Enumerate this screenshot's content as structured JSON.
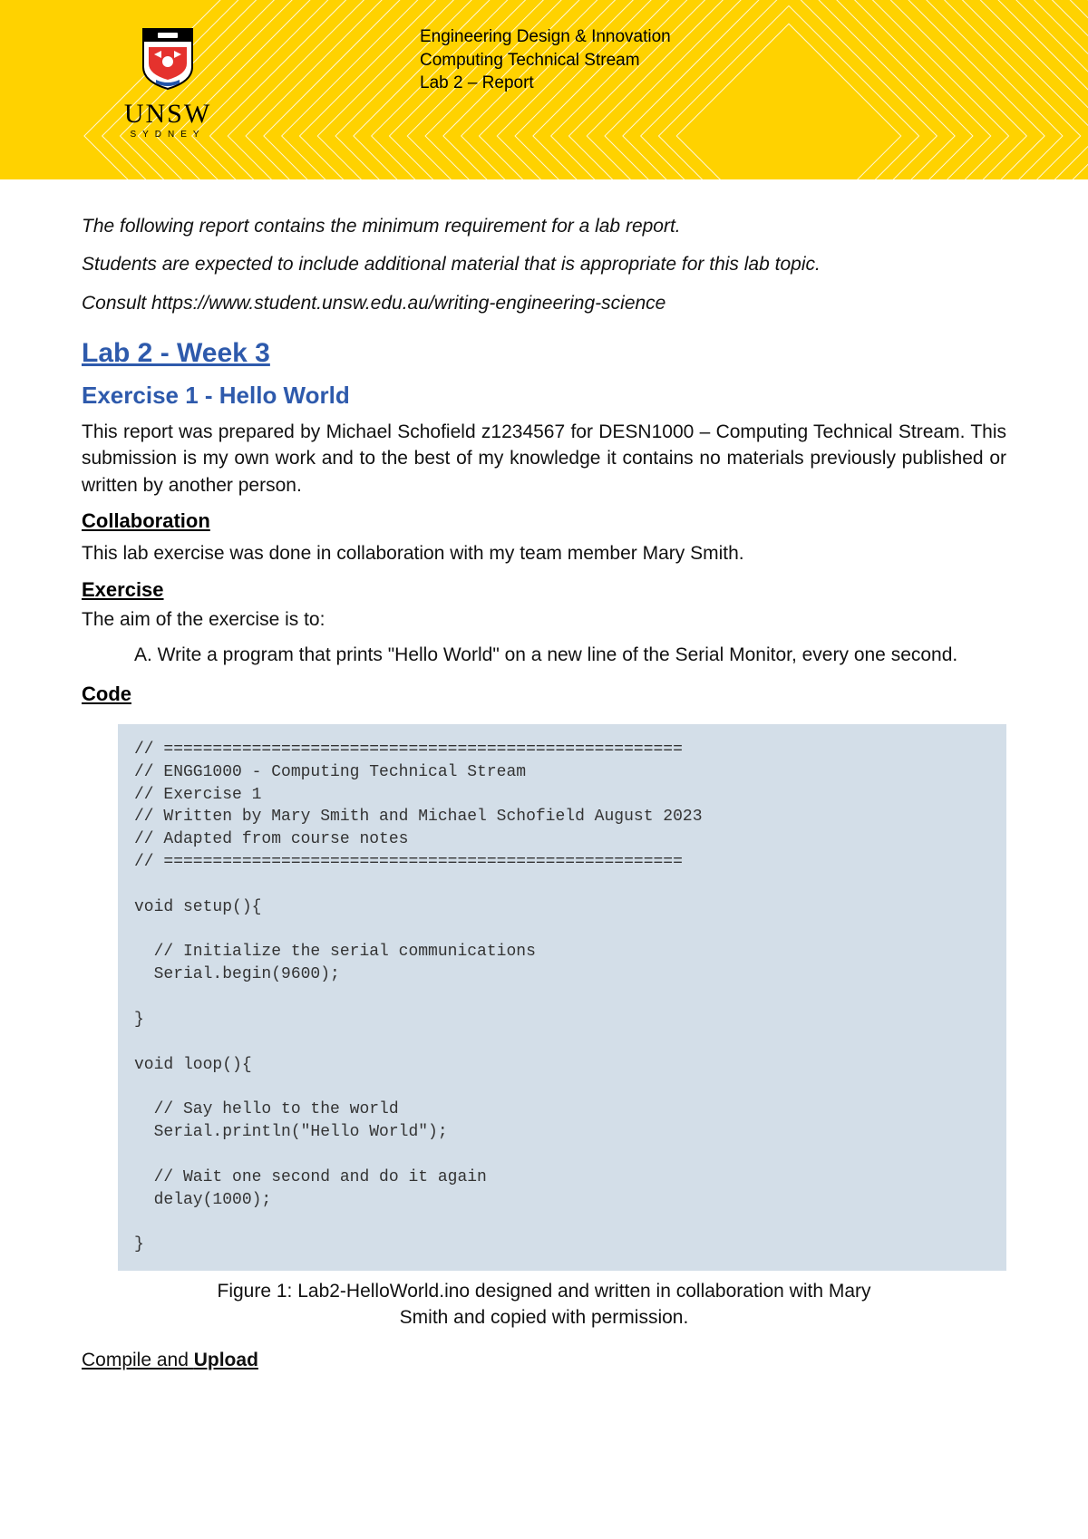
{
  "header": {
    "line1": "Engineering Design & Innovation",
    "line2": "Computing Technical Stream",
    "line3": "Lab 2 – Report",
    "logo_text": "UNSW",
    "logo_sub": "SYDNEY"
  },
  "intro": {
    "p1": "The following report contains the minimum requirement for a lab report.",
    "p2": "Students are expected to include additional material that is appropriate for this lab topic.",
    "p3": "Consult https://www.student.unsw.edu.au/writing-engineering-science"
  },
  "title": "Lab 2 - Week 3",
  "subtitle": "Exercise 1 - Hello World",
  "author_statement": "This report was prepared by Michael Schofield z1234567 for DESN1000 – Computing Technical Stream. This submission is my own work and to the best of my knowledge it contains no materials previously published or written by another person.",
  "sections": {
    "collaboration_heading": "Collaboration",
    "collaboration_text": "This lab exercise was done in collaboration with my team member Mary Smith.",
    "exercise_heading": "Exercise",
    "exercise_aim": "The aim of the exercise is to:",
    "exercise_item": "A. Write a program that prints \"Hello World\" on a new line of the Serial Monitor, every one second.",
    "code_heading": "Code",
    "compile_prefix": "Compile and ",
    "compile_bold": "Upload"
  },
  "code": "// =====================================================\n// ENGG1000 - Computing Technical Stream\n// Exercise 1\n// Written by Mary Smith and Michael Schofield August 2023\n// Adapted from course notes\n// =====================================================\n\nvoid setup(){\n\n  // Initialize the serial communications\n  Serial.begin(9600);\n\n}\n\nvoid loop(){\n\n  // Say hello to the world\n  Serial.println(\"Hello World\");\n\n  // Wait one second and do it again\n  delay(1000);\n\n}",
  "figure_caption": "Figure 1: Lab2-HelloWorld.ino designed and written in collaboration with Mary Smith and copied with permission."
}
